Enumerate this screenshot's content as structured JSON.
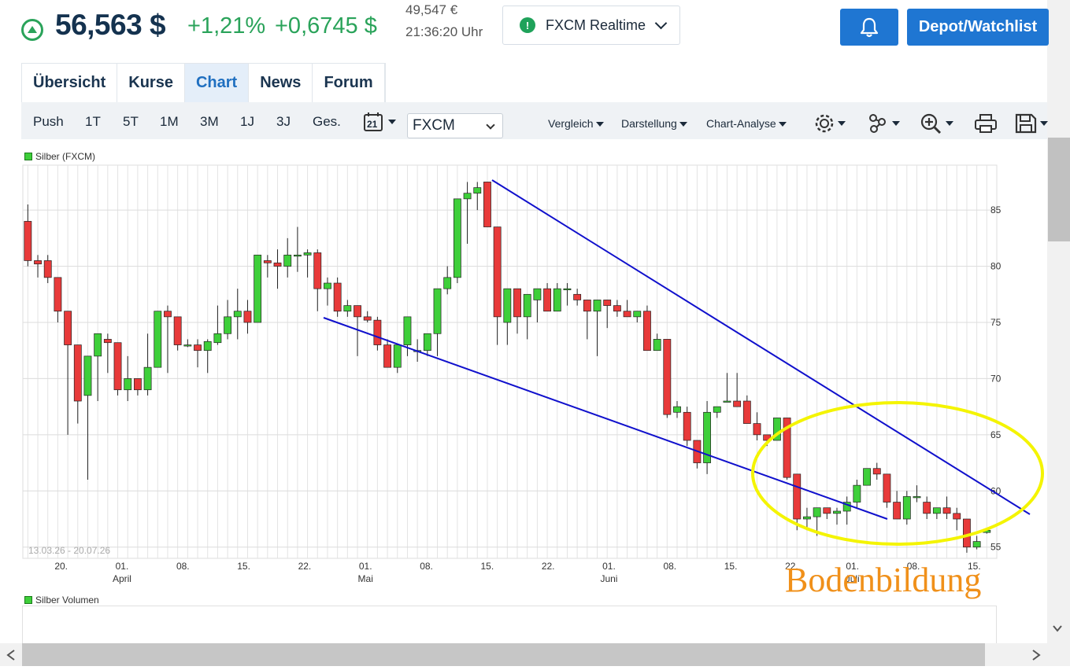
{
  "header": {
    "price": "56,563 $",
    "change_pct": "+1,21%",
    "change_abs": "+0,6745 $",
    "price_eur": "49,547 €",
    "time": "21:36:20 Uhr",
    "feed_label": "FXCM Realtime",
    "depot_label": "Depot/Watchlist"
  },
  "tabs": [
    {
      "label": "Übersicht",
      "active": false
    },
    {
      "label": "Kurse",
      "active": false
    },
    {
      "label": "Chart",
      "active": true
    },
    {
      "label": "News",
      "active": false
    },
    {
      "label": "Forum",
      "active": false
    }
  ],
  "toolbar": {
    "ranges": [
      "Push",
      "1T",
      "5T",
      "1M",
      "3M",
      "1J",
      "3J",
      "Ges."
    ],
    "calendar_day": "21",
    "exchange": "FXCM",
    "menus": [
      "Vergleich",
      "Darstellung",
      "Chart-Analyse"
    ],
    "icons": [
      "gear-icon",
      "indicators-icon",
      "zoom-icon",
      "print-icon",
      "save-icon"
    ]
  },
  "chart": {
    "legend": "Silber (FXCM)",
    "volume_legend": "Silber Volumen",
    "date_range": "13.03.26 - 20.07.26",
    "annotation": "Bodenbildung",
    "colors": {
      "up": "#3ecf3a",
      "down": "#e83a3a",
      "trendline": "#1010cc",
      "ellipse": "#f4f400",
      "annotation": "#f0901a"
    }
  },
  "chart_data": {
    "type": "candlestick",
    "title": "Silber (FXCM)",
    "y_ticks": [
      55,
      60,
      65,
      70,
      75,
      80,
      85
    ],
    "ylim": [
      54,
      89
    ],
    "x_ticks": [
      {
        "label": "20.",
        "month": ""
      },
      {
        "label": "01.",
        "month": "April"
      },
      {
        "label": "08.",
        "month": ""
      },
      {
        "label": "15.",
        "month": ""
      },
      {
        "label": "22.",
        "month": ""
      },
      {
        "label": "01.",
        "month": "Mai"
      },
      {
        "label": "08.",
        "month": ""
      },
      {
        "label": "15.",
        "month": ""
      },
      {
        "label": "22.",
        "month": ""
      },
      {
        "label": "01.",
        "month": "Juni"
      },
      {
        "label": "08.",
        "month": ""
      },
      {
        "label": "15.",
        "month": ""
      },
      {
        "label": "22.",
        "month": ""
      },
      {
        "label": "01.",
        "month": "Juli"
      },
      {
        "label": "08.",
        "month": ""
      },
      {
        "label": "15.",
        "month": ""
      }
    ],
    "ohlc": [
      [
        84,
        85.5,
        80,
        80.5
      ],
      [
        80.5,
        81,
        79,
        80.2
      ],
      [
        80.5,
        81,
        78.5,
        79
      ],
      [
        79,
        79,
        75,
        76
      ],
      [
        76,
        76,
        65,
        73
      ],
      [
        73,
        73,
        66,
        68
      ],
      [
        68.5,
        71.5,
        61,
        72
      ],
      [
        72,
        73,
        68,
        74
      ],
      [
        73.5,
        74,
        70.5,
        73.2
      ],
      [
        73.2,
        73,
        68.5,
        69
      ],
      [
        69,
        72,
        68,
        70
      ],
      [
        70,
        70,
        68.5,
        69
      ],
      [
        69,
        74,
        68.5,
        71
      ],
      [
        71,
        75,
        71,
        76
      ],
      [
        76,
        76.5,
        70.5,
        75.5
      ],
      [
        75.5,
        73,
        72.5,
        73
      ],
      [
        73,
        73.5,
        72.8,
        73
      ],
      [
        73,
        73.5,
        71,
        72.5
      ],
      [
        72.5,
        73.5,
        70.5,
        73.3
      ],
      [
        73.2,
        76.5,
        73,
        74
      ],
      [
        74,
        77,
        73.5,
        75.5
      ],
      [
        75.5,
        78,
        73.5,
        76
      ],
      [
        76,
        77,
        74,
        75
      ],
      [
        75,
        80.5,
        75,
        81
      ],
      [
        80.5,
        81,
        79,
        80.3
      ],
      [
        80.3,
        81.5,
        78,
        80
      ],
      [
        80,
        82.5,
        79,
        81
      ],
      [
        81,
        83.5,
        79.5,
        81
      ],
      [
        81,
        81.5,
        79,
        81.2
      ],
      [
        81.2,
        81.5,
        76,
        78
      ],
      [
        78,
        79,
        76.5,
        78.5
      ],
      [
        78.5,
        79,
        75.5,
        76
      ],
      [
        76,
        77,
        75.5,
        76.5
      ],
      [
        76.5,
        76.5,
        72,
        75.5
      ],
      [
        75.5,
        76,
        75,
        75.2
      ],
      [
        75.2,
        75.5,
        72.5,
        73
      ],
      [
        73,
        73.5,
        71,
        71
      ],
      [
        71,
        72,
        70.5,
        73
      ],
      [
        73,
        74,
        72,
        75.5
      ],
      [
        72.5,
        73.5,
        71.5,
        72.5
      ],
      [
        72.5,
        73,
        72,
        74
      ],
      [
        74,
        75,
        72,
        78
      ],
      [
        78,
        80,
        77.5,
        79
      ],
      [
        79,
        81,
        78.5,
        86
      ],
      [
        86,
        87.5,
        82,
        86.5
      ],
      [
        86.5,
        87.5,
        85,
        87
      ],
      [
        87.5,
        87.5,
        83.5,
        83.5
      ],
      [
        83.5,
        83.5,
        73,
        75.5
      ],
      [
        75,
        75.5,
        73,
        78
      ],
      [
        78,
        78,
        74,
        75.5
      ],
      [
        75.5,
        77.5,
        73.5,
        77.5
      ],
      [
        77,
        77.5,
        75,
        78
      ],
      [
        78,
        78.5,
        76,
        76
      ],
      [
        76,
        78.5,
        77.5,
        78
      ],
      [
        78,
        78.5,
        76.5,
        78
      ],
      [
        77.5,
        78,
        76.5,
        77
      ],
      [
        77,
        77,
        73.5,
        76
      ],
      [
        76,
        77,
        72,
        77
      ],
      [
        77,
        77,
        74.5,
        76.5
      ],
      [
        76.5,
        77,
        75.5,
        76
      ],
      [
        76,
        77,
        75.5,
        75.5
      ],
      [
        75.5,
        76,
        75,
        76
      ],
      [
        76,
        76.5,
        72.5,
        72.5
      ],
      [
        72.5,
        74,
        72.5,
        73.5
      ],
      [
        73.5,
        73.5,
        66.5,
        66.8
      ],
      [
        67,
        68,
        66.5,
        67.5
      ],
      [
        67,
        67.5,
        64,
        64.5
      ],
      [
        64.5,
        64.5,
        62,
        62.5
      ],
      [
        62.5,
        68,
        61.5,
        67
      ],
      [
        67,
        67.5,
        66.5,
        67.5
      ],
      [
        68,
        70.5,
        68,
        68
      ],
      [
        68,
        70.5,
        67.5,
        67.5
      ],
      [
        68,
        68.5,
        66,
        66
      ],
      [
        66,
        67,
        64.5,
        65
      ],
      [
        65,
        65,
        64,
        64.5
      ],
      [
        64.5,
        66.5,
        64.5,
        66.5
      ],
      [
        66.5,
        66.5,
        61,
        61.2
      ],
      [
        61.5,
        61.5,
        56.5,
        57.5
      ],
      [
        57.5,
        58.5,
        56.5,
        57.7
      ],
      [
        57.7,
        58.5,
        56,
        58.5
      ],
      [
        58.5,
        58.5,
        57.5,
        58
      ],
      [
        58,
        58.5,
        57,
        58.2
      ],
      [
        58.2,
        59.5,
        57,
        59
      ],
      [
        59,
        61,
        58.5,
        60.5
      ],
      [
        60.5,
        62,
        60.5,
        62
      ],
      [
        62,
        62.5,
        61,
        61.5
      ],
      [
        61.5,
        61.5,
        58.5,
        59
      ],
      [
        59,
        60,
        57.5,
        57.5
      ],
      [
        57.5,
        60,
        57,
        59.5
      ],
      [
        59.5,
        60.5,
        59,
        59.5
      ],
      [
        59,
        59.5,
        57.5,
        58
      ],
      [
        58,
        58.5,
        57.5,
        58.5
      ],
      [
        58.5,
        59.5,
        57.5,
        58
      ],
      [
        58,
        58.5,
        56.5,
        57.5
      ],
      [
        57.5,
        57.5,
        54.5,
        55
      ],
      [
        55,
        56,
        54.8,
        55.5
      ],
      [
        56.3,
        56.5,
        56.2,
        56.5
      ]
    ]
  }
}
